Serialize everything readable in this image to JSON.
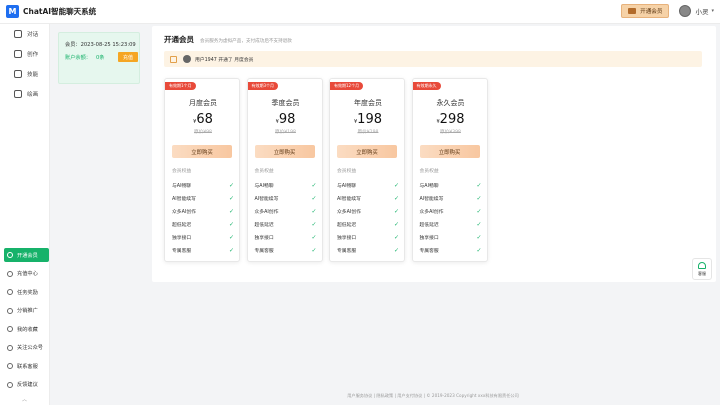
{
  "app": {
    "logo_glyph": "M",
    "name": "ChatAI智能聊天系统"
  },
  "topbar": {
    "vip_label": "开通会员",
    "username": "小灵",
    "caret": "▾"
  },
  "leftnav": {
    "top_items": [
      {
        "label": "对话",
        "icon": "chat-icon"
      },
      {
        "label": "创作",
        "icon": "pen-icon"
      },
      {
        "label": "技能",
        "icon": "skill-icon"
      },
      {
        "label": "绘画",
        "icon": "paint-icon"
      }
    ],
    "bottom_items": [
      {
        "label": "开通会员",
        "icon": "diamond-icon",
        "active": true
      },
      {
        "label": "充值中心",
        "icon": "wallet-icon"
      },
      {
        "label": "任务奖励",
        "icon": "gift-icon"
      },
      {
        "label": "分销推广",
        "icon": "share-icon"
      },
      {
        "label": "我的收藏",
        "icon": "star-icon"
      },
      {
        "label": "关注公众号",
        "icon": "wechat-icon"
      },
      {
        "label": "联系客服",
        "icon": "headset-icon"
      },
      {
        "label": "反馈建议",
        "icon": "feedback-icon"
      }
    ],
    "collapse_glyph": "︿"
  },
  "member": {
    "expire_label": "会员：",
    "expire_value": "2023-08-25 15:23:09",
    "balance_label": "账户余额：",
    "balance_value": "0条",
    "recharge_label": "充值"
  },
  "main": {
    "title": "开通会员",
    "subtitle": "会员服务为虚拟产品，支付成功后不支持退款",
    "notice": "用户1947 开通了 月度会员"
  },
  "plans": [
    {
      "badge": "有效期1个月",
      "name": "月度会员",
      "currency": "¥",
      "price": "68",
      "original": "原价¥98",
      "buy_label": "立即购买"
    },
    {
      "badge": "有效期3个月",
      "name": "季度会员",
      "currency": "¥",
      "price": "98",
      "original": "原价¥198",
      "buy_label": "立即购买"
    },
    {
      "badge": "有效期12个月",
      "name": "年度会员",
      "currency": "¥",
      "price": "198",
      "original": "原价¥298",
      "buy_label": "立即购买"
    },
    {
      "badge": "有效期永久",
      "name": "永久会员",
      "currency": "¥",
      "price": "298",
      "original": "原价¥398",
      "buy_label": "立即购买"
    }
  ],
  "rights_title": "会员权益",
  "rights": [
    "与AI畅聊",
    "AI智能续写",
    "众多AI创作",
    "超低延迟",
    "独享接口",
    "专属客服"
  ],
  "check_glyph": "✓",
  "service_label": "客服",
  "footer": "用户服务协议 | 隐私政策 | 用户支付协议 | © 2019-2023 Copyright xxx科技有限责任公司"
}
